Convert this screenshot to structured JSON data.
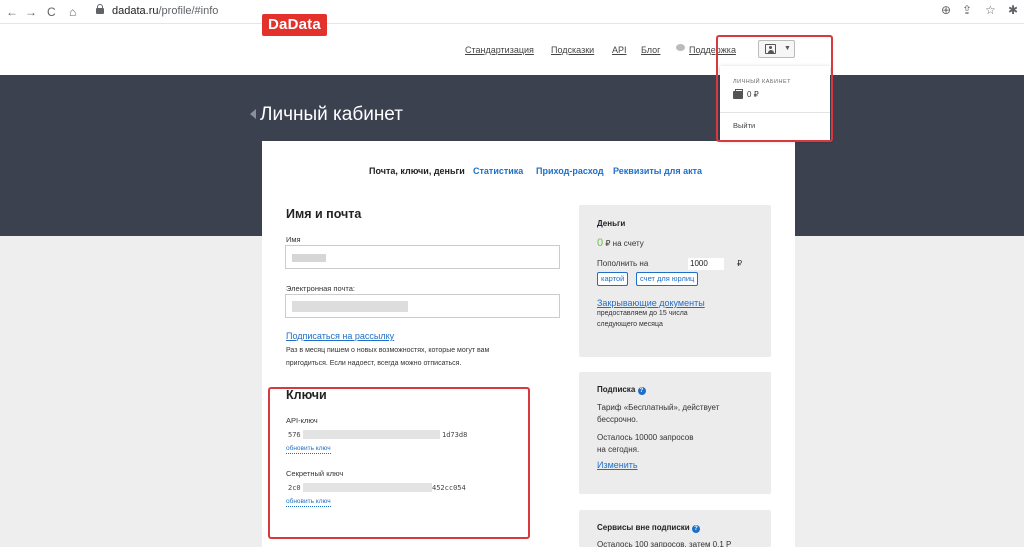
{
  "browser": {
    "back": "←",
    "forward": "→",
    "reload": "C",
    "home": "⌂",
    "url_host": "dadata.ru",
    "url_path": "/profile/#info",
    "zoom_icon": "⊕",
    "share_icon": "⇪",
    "star_icon": "☆",
    "ext_icon": "✱"
  },
  "header": {
    "logo": "DaData",
    "nav": [
      "Стандартизация",
      "Подсказки",
      "API",
      "Блог",
      "Поддержка"
    ]
  },
  "page_title": "Личный кабинет",
  "tabs": [
    "Почта, ключи, деньги",
    "Статистика",
    "Приход-расход",
    "Реквизиты для акта"
  ],
  "profile": {
    "heading": "Имя и почта",
    "name_label": "Имя",
    "email_label": "Электронная почта:",
    "subscribe_link": "Подписаться на рассылку",
    "subscribe_text_1": "Раз в месяц пишем о новых возможностях, которые могут вам",
    "subscribe_text_2": "пригодиться. Если надоест, всегда можно отписаться."
  },
  "keys": {
    "heading": "Ключи",
    "api_label": "API-ключ",
    "api_prefix": "576",
    "api_suffix": "1d73d8",
    "api_refresh": "обновить ключ",
    "secret_label": "Секретный ключ",
    "secret_prefix": "2c0",
    "secret_suffix": "452cc054",
    "secret_refresh": "обновить ключ"
  },
  "money": {
    "title": "Деньги",
    "balance_value": "0",
    "balance_text": "₽ на счету",
    "topup_label": "Пополнить на",
    "topup_amount": "1000",
    "currency": "₽",
    "btn_card": "картой",
    "btn_invoice": "счет для юрлиц",
    "docs_link": "Закрывающие документы",
    "docs_note_1": "предоставляем до 15 числа",
    "docs_note_2": "следующего месяца"
  },
  "subscription": {
    "title": "Подписка",
    "tariff_1": "Тариф «Бесплатный», действует",
    "tariff_2": "бессрочно.",
    "remaining_1": "Осталось 10000 запросов",
    "remaining_2": "на сегодня.",
    "change_link": "Изменить"
  },
  "services": {
    "title": "Сервисы вне подписки",
    "text": "Осталось 100 запросов, затем 0,1 Р"
  },
  "dropdown": {
    "label": "ЛИЧНЫЙ КАБИНЕТ",
    "balance": "0 ₽",
    "logout": "Выйти"
  },
  "colors": {
    "brand": "#e2322b",
    "link": "#1e6fc8",
    "dark_band": "#3c4150",
    "highlight": "#d9383c",
    "positive": "#6dbe45"
  }
}
